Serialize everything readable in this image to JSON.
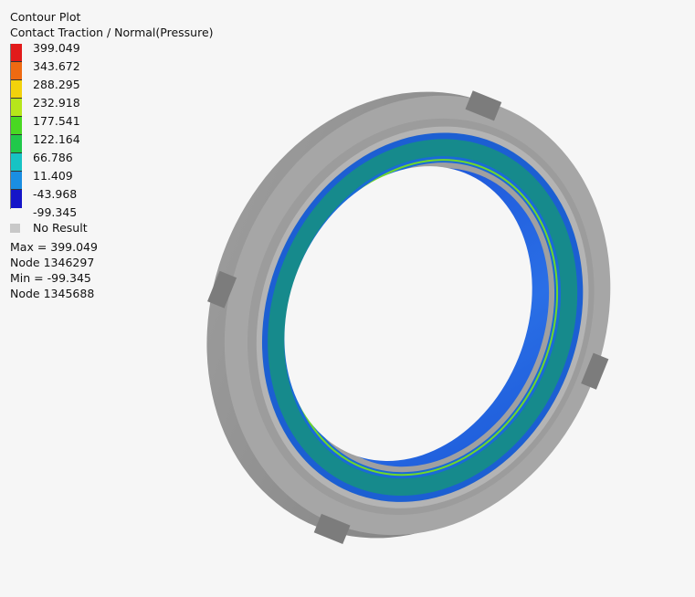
{
  "legend": {
    "title": "Contour Plot",
    "subtitle": "Contact Traction / Normal(Pressure)",
    "scale_values": [
      "399.049",
      "343.672",
      "288.295",
      "232.918",
      "177.541",
      "122.164",
      "66.786",
      "11.409",
      "-43.968",
      "-99.345"
    ],
    "scale_colors": [
      "#e21a1a",
      "#ef6a12",
      "#f2d20c",
      "#b6e61a",
      "#49d822",
      "#20c84a",
      "#17c3c4",
      "#1a8ee2",
      "#1f4fe6",
      "#1515c8"
    ],
    "no_result_label": "No Result",
    "max_text": "Max = 399.049",
    "max_node": "Node 1346297",
    "min_text": "Min = -99.345",
    "min_node": "Node 1345688"
  },
  "model": {
    "name": "contact-ring",
    "outer_color": "#8f8f8f",
    "face_color": "#a4a4a4",
    "band_color": "#1a8a8c",
    "edge_blue": "#1a5fd0",
    "inner_blue": "#2266dd"
  }
}
